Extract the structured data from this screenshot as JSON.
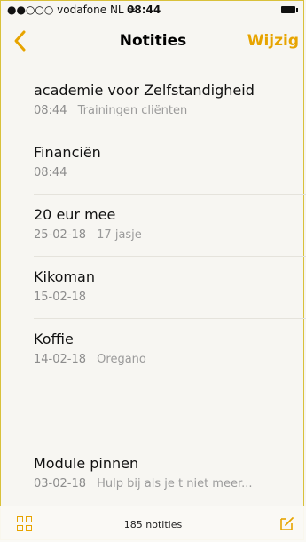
{
  "statusbar": {
    "carrier": "●●○○○ vodafone NL ≈",
    "time": "08:44"
  },
  "navbar": {
    "back_icon": "chevron-left-icon",
    "title": "Notities",
    "edit_label": "Wijzig"
  },
  "notes": [
    {
      "title": "academie voor Zelfstandigheid",
      "date": "08:44",
      "preview": "Trainingen cliënten"
    },
    {
      "title": "Financiën",
      "date": "08:44",
      "preview": ""
    },
    {
      "title": "20 eur mee",
      "date": "25-02-18",
      "preview": "17 jasje"
    },
    {
      "title": "Kikoman",
      "date": "15-02-18",
      "preview": ""
    },
    {
      "title": "Koffie",
      "date": "14-02-18",
      "preview": "Oregano"
    },
    {
      "title": "Module pinnen",
      "date": "03-02-18",
      "preview": "Hulp bij als je t niet meer..."
    }
  ],
  "toolbar": {
    "count_label": "185 notities",
    "grid_icon": "grid-icon",
    "compose_icon": "compose-icon"
  },
  "colors": {
    "accent": "#e7a400",
    "background": "#f7f6f2",
    "secondary_text": "#8d8d8d"
  }
}
